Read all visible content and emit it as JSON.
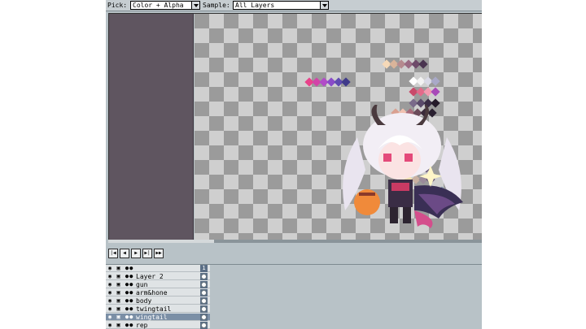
{
  "toolbar": {
    "pick_label": "Pick:",
    "pick_value": "Color + Alpha",
    "sample_label": "Sample:",
    "sample_value": "All Layers"
  },
  "playback": {
    "first_icon": "first-frame-icon",
    "prev_icon": "previous-frame-icon",
    "play_icon": "play-icon",
    "next_icon": "next-frame-icon",
    "last_icon": "last-frame-icon"
  },
  "layers": [
    {
      "name": "",
      "selected": false
    },
    {
      "name": "Layer 2",
      "selected": false
    },
    {
      "name": "gun",
      "selected": false
    },
    {
      "name": "arm&hone",
      "selected": false
    },
    {
      "name": "body",
      "selected": false
    },
    {
      "name": "twingtail",
      "selected": false
    },
    {
      "name": "wingtail",
      "selected": true
    },
    {
      "name": "rep",
      "selected": false
    }
  ],
  "header_frame_number": "1",
  "colors": {
    "panel_bg": "#5f5560",
    "selection": "#7b8fa6",
    "app_bg": "#b8c2c7"
  }
}
